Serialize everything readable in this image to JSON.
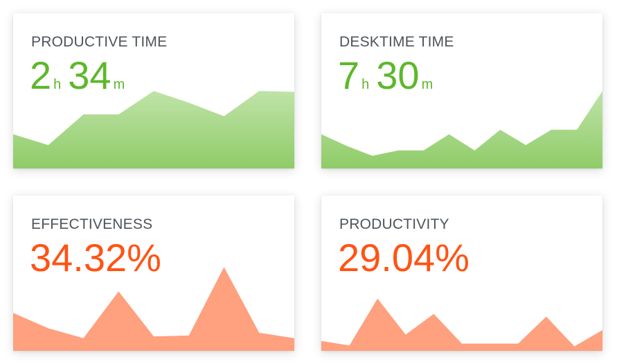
{
  "colors": {
    "green": "#5db82a",
    "green_fill_top": "#bfe3a8",
    "green_fill_bottom": "#8fcc68",
    "orange": "#ff5314",
    "orange_fill": "#ffa07e",
    "title_text": "#4d545a"
  },
  "cards": [
    {
      "id": "productive-time",
      "title": "PRODUCTIVE TIME",
      "hours": "2",
      "hours_unit": "h",
      "minutes": "34",
      "minutes_unit": "m",
      "accent": "green",
      "chart_data": {
        "type": "area",
        "values": [
          0.38,
          0.26,
          0.6,
          0.6,
          0.86,
          0.73,
          0.58,
          0.86,
          0.85
        ]
      }
    },
    {
      "id": "desktime-time",
      "title": "DESKTIME TIME",
      "hours": "7",
      "hours_unit": "h",
      "minutes": "30",
      "minutes_unit": "m",
      "accent": "green",
      "chart_data": {
        "type": "area",
        "values": [
          0.38,
          0.25,
          0.14,
          0.2,
          0.2,
          0.38,
          0.2,
          0.43,
          0.26,
          0.43,
          0.43,
          0.86
        ]
      }
    },
    {
      "id": "effectiveness",
      "title": "EFFECTIVENESS",
      "value": "34.32%",
      "accent": "orange",
      "chart_data": {
        "type": "area",
        "values": [
          0.42,
          0.25,
          0.14,
          0.66,
          0.16,
          0.17,
          0.93,
          0.2,
          0.14
        ]
      }
    },
    {
      "id": "productivity",
      "title": "PRODUCTIVITY",
      "value": "29.04%",
      "accent": "orange",
      "chart_data": {
        "type": "area",
        "values": [
          0.11,
          0.06,
          0.58,
          0.18,
          0.41,
          0.08,
          0.08,
          0.08,
          0.38,
          0.05,
          0.23
        ]
      }
    }
  ]
}
